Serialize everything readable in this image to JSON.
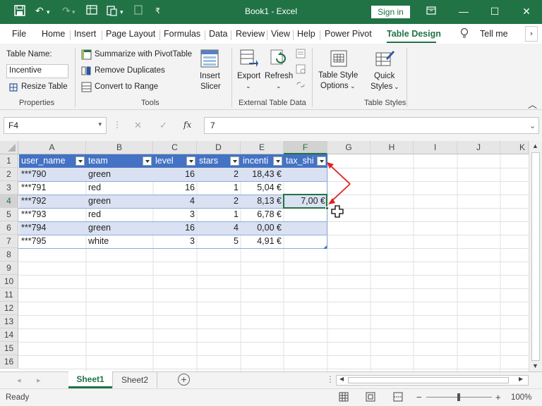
{
  "titlebar": {
    "title": "Book1 - Excel",
    "signin": "Sign in"
  },
  "tabs": [
    "File",
    "Home",
    "Insert",
    "Page Layout",
    "Formulas",
    "Data",
    "Review",
    "View",
    "Help",
    "Power Pivot",
    "Table Design",
    "Tell me"
  ],
  "active_tab": "Table Design",
  "ribbon": {
    "properties": {
      "table_name_label": "Table Name:",
      "table_name_value": "Incentive",
      "resize": "Resize Table",
      "group": "Properties"
    },
    "tools": {
      "summarize": "Summarize with PivotTable",
      "remove_duplicates": "Remove Duplicates",
      "convert": "Convert to Range",
      "insert_slicer_1": "Insert",
      "insert_slicer_2": "Slicer",
      "group": "Tools"
    },
    "external": {
      "export": "Export",
      "refresh": "Refresh",
      "group": "External Table Data"
    },
    "styles": {
      "options_1": "Table Style",
      "options_2": "Options",
      "quick_1": "Quick",
      "quick_2": "Styles",
      "group": "Table Styles"
    }
  },
  "formula_bar": {
    "name_box": "F4",
    "formula": "7",
    "fx": "fx"
  },
  "columns": [
    "A",
    "B",
    "C",
    "D",
    "E",
    "F",
    "G",
    "H",
    "I",
    "J",
    "K"
  ],
  "rows": [
    "1",
    "2",
    "3",
    "4",
    "5",
    "6",
    "7",
    "8",
    "9",
    "10",
    "11",
    "12",
    "13",
    "14",
    "15",
    "16"
  ],
  "table": {
    "headers": [
      "user_name",
      "team",
      "level",
      "stars",
      "incenti",
      "tax_shi"
    ],
    "rows": [
      [
        "***790",
        "green",
        "16",
        "2",
        "18,43 €",
        ""
      ],
      [
        "***791",
        "red",
        "16",
        "1",
        "5,04 €",
        ""
      ],
      [
        "***792",
        "green",
        "4",
        "2",
        "8,13 €",
        "7,00 €"
      ],
      [
        "***793",
        "red",
        "3",
        "1",
        "6,78 €",
        ""
      ],
      [
        "***794",
        "green",
        "16",
        "4",
        "0,00 €",
        ""
      ],
      [
        "***795",
        "white",
        "3",
        "5",
        "4,91 €",
        ""
      ]
    ],
    "header_color": "#4472c4",
    "band_color": "#d9e1f2"
  },
  "sheets": [
    "Sheet1",
    "Sheet2"
  ],
  "active_sheet": "Sheet1",
  "status": {
    "ready": "Ready",
    "zoom": "100%",
    "zoom_minus": "−",
    "zoom_plus": "+"
  },
  "annotation_color": "#e02020"
}
